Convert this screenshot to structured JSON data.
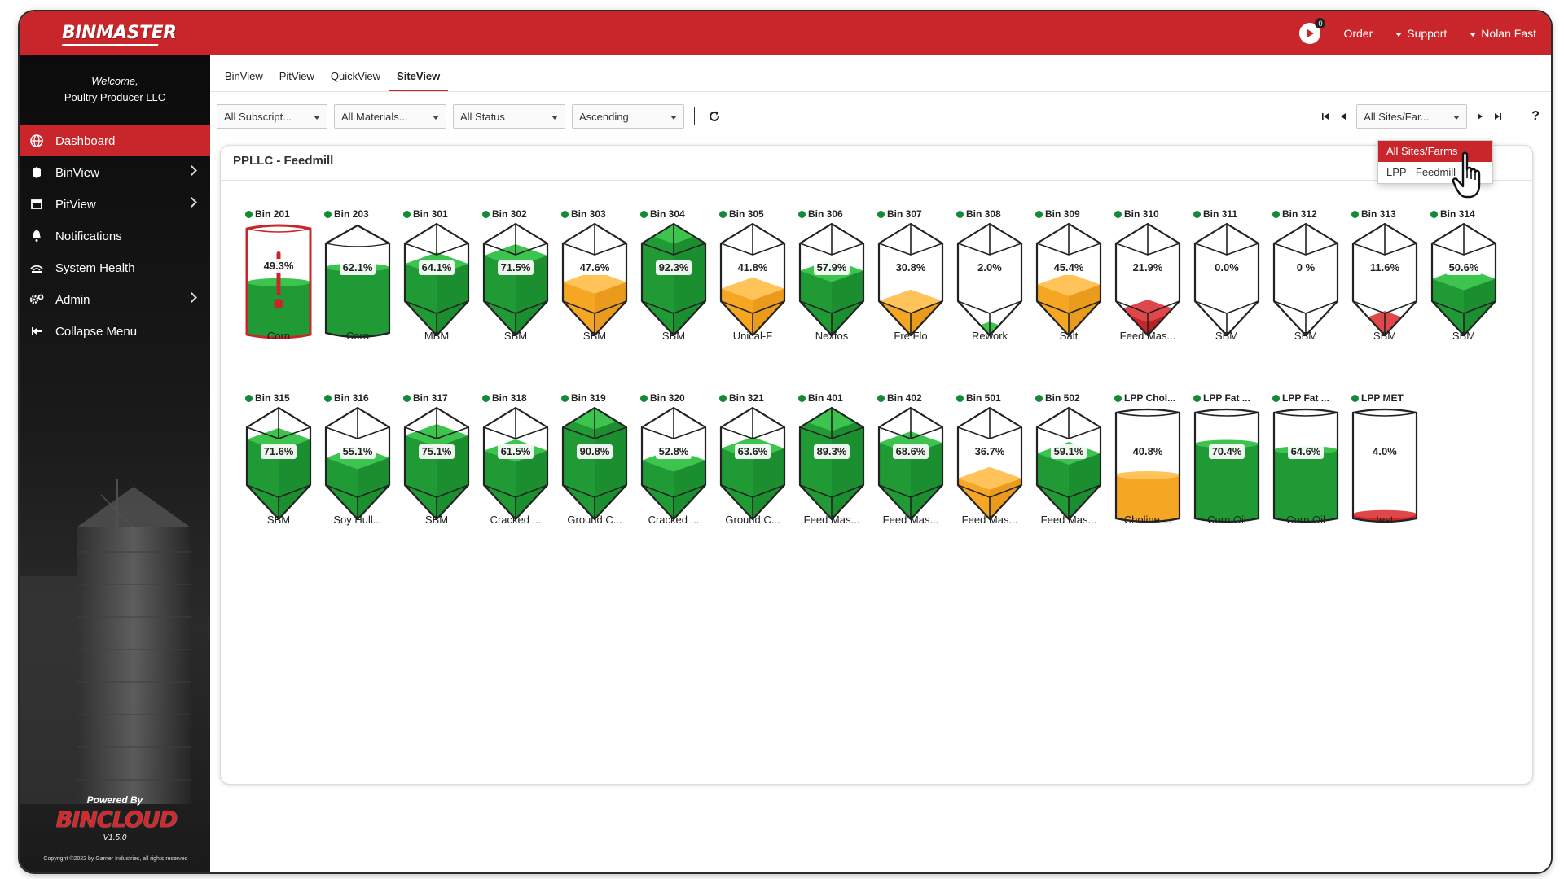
{
  "brand": {
    "logo_text": "BINMASTER"
  },
  "topbar": {
    "notifications_count": "0",
    "order_label": "Order",
    "support_label": "Support",
    "user_label": "Nolan Fast"
  },
  "sidebar": {
    "welcome_line1": "Welcome,",
    "welcome_line2": "Poultry Producer LLC",
    "items": [
      {
        "label": "Dashboard",
        "icon": "globe-icon",
        "active": true,
        "has_submenu": false
      },
      {
        "label": "BinView",
        "icon": "bin-icon",
        "active": false,
        "has_submenu": true
      },
      {
        "label": "PitView",
        "icon": "pit-icon",
        "active": false,
        "has_submenu": true
      },
      {
        "label": "Notifications",
        "icon": "bell-icon",
        "active": false,
        "has_submenu": false
      },
      {
        "label": "System Health",
        "icon": "signal-icon",
        "active": false,
        "has_submenu": false
      },
      {
        "label": "Admin",
        "icon": "gears-icon",
        "active": false,
        "has_submenu": true
      },
      {
        "label": "Collapse Menu",
        "icon": "collapse-icon",
        "active": false,
        "has_submenu": false
      }
    ],
    "powered_by": "Powered By",
    "product": "BINCLOUD",
    "version": "V1.5.0",
    "copyright": "Copyright ©2022 by Garner Industries, all rights reserved"
  },
  "tabs": [
    "BinView",
    "PitView",
    "QuickView",
    "SiteView"
  ],
  "active_tab": "SiteView",
  "filters": {
    "subscription": "All Subscript...",
    "materials": "All Materials...",
    "status": "All Status",
    "sort": "Ascending",
    "site": "All Sites/Far..."
  },
  "site_dropdown": {
    "options": [
      "All Sites/Farms",
      "LPP - Feedmill"
    ],
    "selected": "All Sites/Farms"
  },
  "help_label": "?",
  "panel": {
    "title": "PPLLC - Feedmill"
  },
  "colors": {
    "brand_red": "#c8262a",
    "level_green": "#1f9a35",
    "level_orange": "#f5a623",
    "level_red": "#c8262a",
    "status_green": "#138a36"
  },
  "bins": [
    {
      "name": "Bin 201",
      "material": "Corn",
      "level": "49.3%",
      "fill": 0.493,
      "shape": "flat",
      "color": "green",
      "outline": "red",
      "thermo": true
    },
    {
      "name": "Bin 203",
      "material": "Corn",
      "level": "62.1%",
      "fill": 0.621,
      "shape": "peak",
      "color": "green"
    },
    {
      "name": "Bin 301",
      "material": "MBM",
      "level": "64.1%",
      "fill": 0.641,
      "shape": "hopper",
      "color": "green"
    },
    {
      "name": "Bin 302",
      "material": "SBM",
      "level": "71.5%",
      "fill": 0.715,
      "shape": "hopper",
      "color": "green"
    },
    {
      "name": "Bin 303",
      "material": "SBM",
      "level": "47.6%",
      "fill": 0.476,
      "shape": "hopper",
      "color": "orange"
    },
    {
      "name": "Bin 304",
      "material": "SBM",
      "level": "92.3%",
      "fill": 0.923,
      "shape": "hopper",
      "color": "green"
    },
    {
      "name": "Bin 305",
      "material": "Unical-F",
      "level": "41.8%",
      "fill": 0.418,
      "shape": "hopper",
      "color": "orange"
    },
    {
      "name": "Bin 306",
      "material": "Nexfos",
      "level": "57.9%",
      "fill": 0.579,
      "shape": "hopper",
      "color": "green"
    },
    {
      "name": "Bin 307",
      "material": "Fre Flo",
      "level": "30.8%",
      "fill": 0.308,
      "shape": "hopper",
      "color": "orange"
    },
    {
      "name": "Bin 308",
      "material": "Rework",
      "level": "2.0%",
      "fill": 0.02,
      "shape": "hopper",
      "color": "green"
    },
    {
      "name": "Bin 309",
      "material": "Salt",
      "level": "45.4%",
      "fill": 0.454,
      "shape": "hopper",
      "color": "orange"
    },
    {
      "name": "Bin 310",
      "material": "Feed Mas...",
      "level": "21.9%",
      "fill": 0.219,
      "shape": "hopper",
      "color": "red"
    },
    {
      "name": "Bin 311",
      "material": "SBM",
      "level": "0.0%",
      "fill": 0.0,
      "shape": "hopper",
      "color": "green"
    },
    {
      "name": "Bin 312",
      "material": "SBM",
      "level": "0 %",
      "fill": 0.0,
      "shape": "hopper",
      "color": "green"
    },
    {
      "name": "Bin 313",
      "material": "SBM",
      "level": "11.6%",
      "fill": 0.116,
      "shape": "hopper",
      "color": "red"
    },
    {
      "name": "Bin 314",
      "material": "SBM",
      "level": "50.6%",
      "fill": 0.506,
      "shape": "hopper",
      "color": "green"
    },
    {
      "name": "Bin 315",
      "material": "SBM",
      "level": "71.6%",
      "fill": 0.716,
      "shape": "hopper",
      "color": "green"
    },
    {
      "name": "Bin 316",
      "material": "Soy Hull...",
      "level": "55.1%",
      "fill": 0.551,
      "shape": "hopper",
      "color": "green"
    },
    {
      "name": "Bin 317",
      "material": "SBM",
      "level": "75.1%",
      "fill": 0.751,
      "shape": "hopper",
      "color": "green"
    },
    {
      "name": "Bin 318",
      "material": "Cracked ...",
      "level": "61.5%",
      "fill": 0.615,
      "shape": "hopper",
      "color": "green"
    },
    {
      "name": "Bin 319",
      "material": "Ground C...",
      "level": "90.8%",
      "fill": 0.908,
      "shape": "hopper",
      "color": "green"
    },
    {
      "name": "Bin 320",
      "material": "Cracked ...",
      "level": "52.8%",
      "fill": 0.528,
      "shape": "hopper",
      "color": "green"
    },
    {
      "name": "Bin 321",
      "material": "Ground C...",
      "level": "63.6%",
      "fill": 0.636,
      "shape": "hopper",
      "color": "green"
    },
    {
      "name": "Bin 401",
      "material": "Feed Mas...",
      "level": "89.3%",
      "fill": 0.893,
      "shape": "hopper",
      "color": "green"
    },
    {
      "name": "Bin 402",
      "material": "Feed Mas...",
      "level": "68.6%",
      "fill": 0.686,
      "shape": "hopper",
      "color": "green"
    },
    {
      "name": "Bin 501",
      "material": "Feed Mas...",
      "level": "36.7%",
      "fill": 0.367,
      "shape": "hopper",
      "color": "orange"
    },
    {
      "name": "Bin 502",
      "material": "Feed Mas...",
      "level": "59.1%",
      "fill": 0.591,
      "shape": "hopper",
      "color": "green"
    },
    {
      "name": "LPP Chol...",
      "material": "Choline ...",
      "level": "40.8%",
      "fill": 0.408,
      "shape": "tank",
      "color": "orange"
    },
    {
      "name": "LPP Fat ...",
      "material": "Corn Oil",
      "level": "70.4%",
      "fill": 0.704,
      "shape": "tank",
      "color": "green"
    },
    {
      "name": "LPP Fat ...",
      "material": "Corn Oil",
      "level": "64.6%",
      "fill": 0.646,
      "shape": "tank",
      "color": "green"
    },
    {
      "name": "LPP MET",
      "material": "test",
      "level": "4.0%",
      "fill": 0.04,
      "shape": "tank",
      "color": "red"
    }
  ]
}
